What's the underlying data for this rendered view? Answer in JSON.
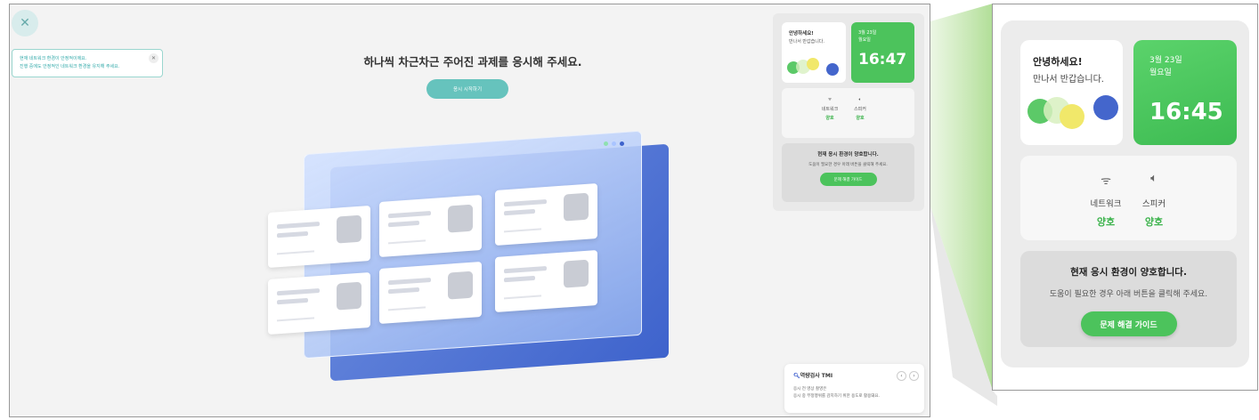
{
  "main": {
    "close_icon": "✕",
    "notice": {
      "line1": "현재 네트워크 환경이 안정적이에요.",
      "line2": "진행 중에도 안정적인 네트워크 환경을 유지해 주세요.",
      "close_icon": "✕"
    },
    "headline": "하나씩 차근차근 주어진 과제를 응시해 주세요.",
    "start_button": "응시 시작하기",
    "tmi": {
      "title": "역량검사 TMI",
      "line1": "응시 전 영상 촬영은",
      "line2": "응시 중 부정행위를 감지하기 위한 용도로 활용돼요.",
      "prev": "‹",
      "next": "›"
    }
  },
  "status_panel": {
    "greeting_title": "안녕하세요!",
    "greeting_sub": "만나서 반갑습니다.",
    "date": "3월 23일",
    "weekday": "월요일",
    "time_small": "16:47",
    "time_large": "16:45",
    "network_label": "네트워크",
    "network_value": "양호",
    "speaker_label": "스피커",
    "speaker_value": "양호",
    "env_title": "현재 응시 환경이 양호합니다.",
    "env_desc": "도움이 필요한 경우 아래 버튼을 클릭해 주세요.",
    "guide_button": "문제 해결 가이드",
    "wifi_icon": "wifi-icon",
    "speaker_icon": "speaker-icon"
  },
  "colors": {
    "accent_green": "#4cc35c",
    "teal": "#66c3bd",
    "blue": "#3e63cc"
  }
}
